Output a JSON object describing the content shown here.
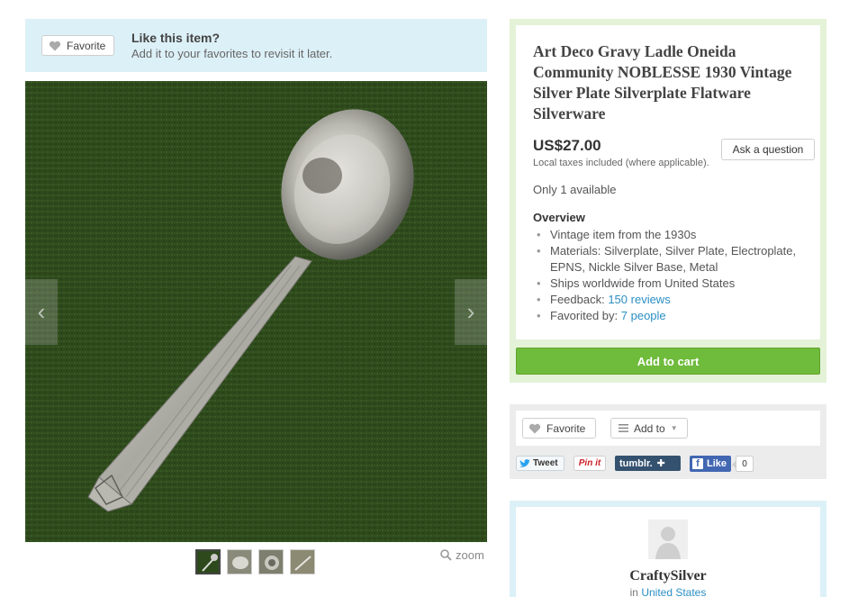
{
  "favorite_banner": {
    "button_label": "Favorite",
    "heading": "Like this item?",
    "subtext": "Add it to your favorites to revisit it later."
  },
  "gallery": {
    "prev_icon": "chevron-left-icon",
    "next_icon": "chevron-right-icon",
    "thumbnail_count": 4,
    "zoom_label": "zoom"
  },
  "listing": {
    "title": "Art Deco Gravy Ladle Oneida Community NOBLESSE 1930 Vintage Silver Plate Silverplate Flatware Silverware",
    "price": "US$27.00",
    "taxes_note": "Local taxes included (where applicable).",
    "ask_question_label": "Ask a question",
    "availability": "Only 1 available",
    "overview_heading": "Overview",
    "overview": {
      "item1": "Vintage item from the 1930s",
      "item2": "Materials: Silverplate, Silver Plate, Electroplate, EPNS, Nickle Silver Base, Metal",
      "item3": "Ships worldwide from United States",
      "feedback_label": "Feedback: ",
      "feedback_link": "150 reviews",
      "favorited_label": "Favorited by: ",
      "favorited_link": "7 people"
    },
    "add_to_cart_label": "Add to cart"
  },
  "social": {
    "favorite_label": "Favorite",
    "add_to_label": "Add to",
    "tweet_label": "Tweet",
    "pinit_label": "Pin it",
    "tumblr_label": "tumblr.",
    "like_label": "Like",
    "like_count": "0"
  },
  "shop": {
    "name": "CraftySilver",
    "location_prefix": "in ",
    "location": "United States"
  },
  "colors": {
    "cart_green": "#6fbb3b",
    "link_blue": "#2b8fc4",
    "banner_blue": "#dcf0f7",
    "listing_border_green": "#e4f2d7"
  }
}
